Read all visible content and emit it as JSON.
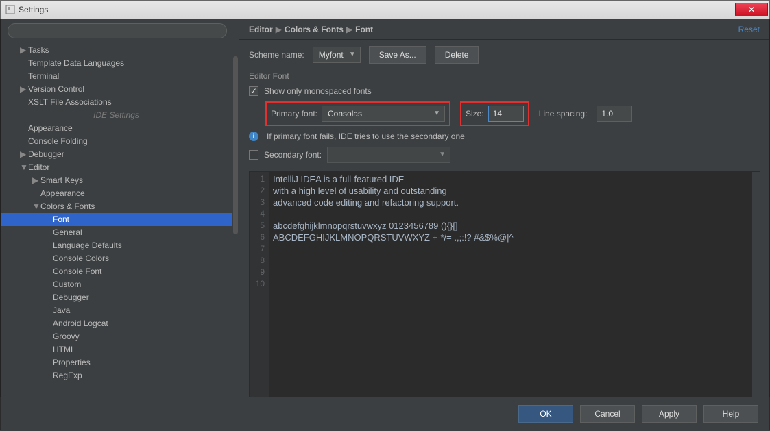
{
  "window": {
    "title": "Settings",
    "close_glyph": "✕"
  },
  "search": {
    "placeholder": ""
  },
  "tree": {
    "items": [
      {
        "label": "Tasks",
        "indent": 1,
        "arrow": "▶"
      },
      {
        "label": "Template Data Languages",
        "indent": 1,
        "arrow": ""
      },
      {
        "label": "Terminal",
        "indent": 1,
        "arrow": ""
      },
      {
        "label": "Version Control",
        "indent": 1,
        "arrow": "▶"
      },
      {
        "label": "XSLT File Associations",
        "indent": 1,
        "arrow": ""
      }
    ],
    "ide_header": "IDE Settings",
    "items2": [
      {
        "label": "Appearance",
        "indent": 1,
        "arrow": ""
      },
      {
        "label": "Console Folding",
        "indent": 1,
        "arrow": ""
      },
      {
        "label": "Debugger",
        "indent": 1,
        "arrow": "▶"
      },
      {
        "label": "Editor",
        "indent": 1,
        "arrow": "▼"
      },
      {
        "label": "Smart Keys",
        "indent": 2,
        "arrow": "▶"
      },
      {
        "label": "Appearance",
        "indent": 2,
        "arrow": ""
      },
      {
        "label": "Colors & Fonts",
        "indent": 2,
        "arrow": "▼"
      },
      {
        "label": "Font",
        "indent": 3,
        "arrow": "",
        "selected": true
      },
      {
        "label": "General",
        "indent": 3,
        "arrow": ""
      },
      {
        "label": "Language Defaults",
        "indent": 3,
        "arrow": ""
      },
      {
        "label": "Console Colors",
        "indent": 3,
        "arrow": ""
      },
      {
        "label": "Console Font",
        "indent": 3,
        "arrow": ""
      },
      {
        "label": "Custom",
        "indent": 3,
        "arrow": ""
      },
      {
        "label": "Debugger",
        "indent": 3,
        "arrow": ""
      },
      {
        "label": "Java",
        "indent": 3,
        "arrow": ""
      },
      {
        "label": "Android Logcat",
        "indent": 3,
        "arrow": ""
      },
      {
        "label": "Groovy",
        "indent": 3,
        "arrow": ""
      },
      {
        "label": "HTML",
        "indent": 3,
        "arrow": ""
      },
      {
        "label": "Properties",
        "indent": 3,
        "arrow": ""
      },
      {
        "label": "RegExp",
        "indent": 3,
        "arrow": ""
      }
    ]
  },
  "breadcrumb": {
    "a": "Editor",
    "b": "Colors & Fonts",
    "c": "Font",
    "reset": "Reset"
  },
  "scheme": {
    "label": "Scheme name:",
    "value": "Myfont",
    "save": "Save As...",
    "delete": "Delete"
  },
  "group": {
    "title": "Editor Font",
    "mono_label": "Show only monospaced fonts",
    "mono_checked": "✓",
    "primary_label": "Primary font:",
    "primary_value": "Consolas",
    "size_label": "Size:",
    "size_value": "14",
    "lsp_label": "Line spacing:",
    "lsp_value": "1.0",
    "info_text": "If primary font fails, IDE tries to use the secondary one",
    "secondary_label": "Secondary font:",
    "secondary_value": ""
  },
  "preview": {
    "gutter": [
      "1",
      "2",
      "3",
      "4",
      "5",
      "6",
      "7",
      "8",
      "9",
      "10"
    ],
    "code": "IntelliJ IDEA is a full-featured IDE\nwith a high level of usability and outstanding\nadvanced code editing and refactoring support.\n\nabcdefghijklmnopqrstuvwxyz 0123456789 (){}[]\nABCDEFGHIJKLMNOPQRSTUVWXYZ +-*/= .,;:!? #&$%@|^\n\n\n\n"
  },
  "footer": {
    "ok": "OK",
    "cancel": "Cancel",
    "apply": "Apply",
    "help": "Help"
  }
}
